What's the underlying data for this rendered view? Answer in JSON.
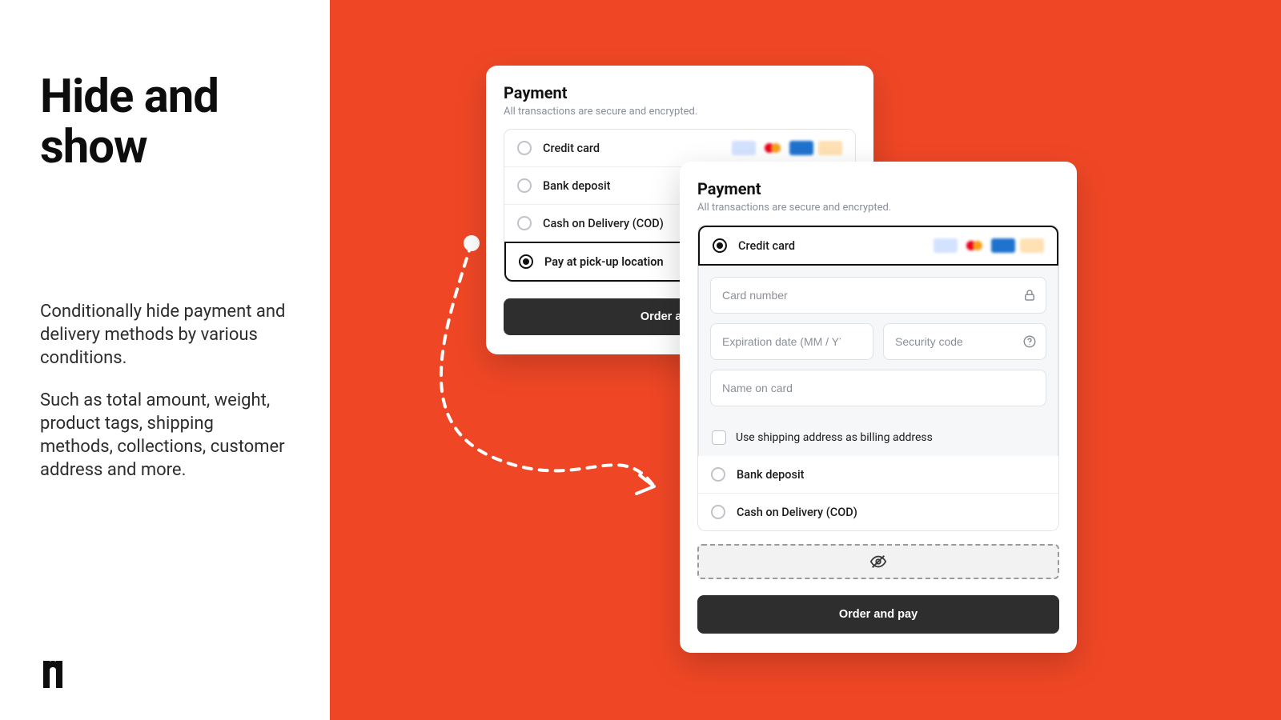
{
  "left": {
    "heading": "Hide and show",
    "p1": "Conditionally hide payment and delivery methods by various conditions.",
    "p2": "Such as total amount, weight, product tags, shipping methods, collections, customer address and more."
  },
  "cardA": {
    "title": "Payment",
    "subtitle": "All transactions are secure and encrypted.",
    "opts": {
      "credit": "Credit card",
      "bank": "Bank deposit",
      "cod": "Cash on Delivery (COD)",
      "pickup": "Pay at pick-up location"
    },
    "button": "Order and pay"
  },
  "cardB": {
    "title": "Payment",
    "subtitle": "All transactions are secure and encrypted.",
    "opts": {
      "credit": "Credit card",
      "bank": "Bank deposit",
      "cod": "Cash on Delivery (COD)"
    },
    "fields": {
      "card_number": "Card number",
      "exp": "Expiration date (MM / YY)",
      "cvc": "Security code",
      "name": "Name on card"
    },
    "useShipping": "Use shipping address as billing address",
    "button": "Order and pay"
  }
}
